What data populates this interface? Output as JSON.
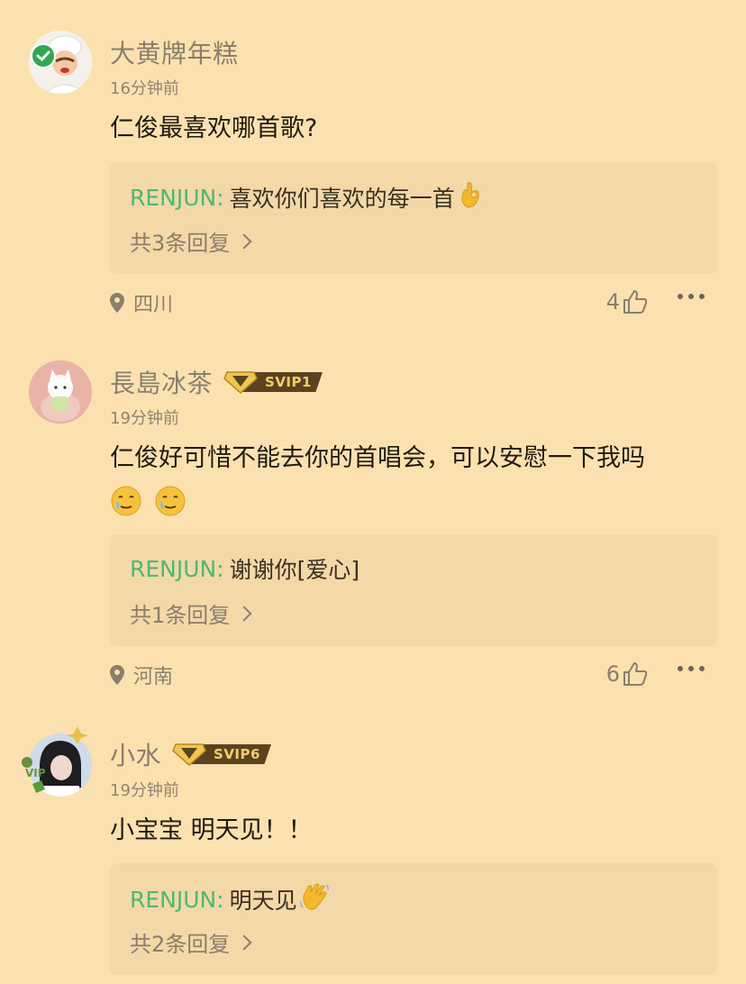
{
  "comments": [
    {
      "username": "大黄牌年糕",
      "time": "16分钟前",
      "text": "仁俊最喜欢哪首歌?",
      "reply": {
        "author": "RENJUN:",
        "text": "喜欢你们喜欢的每一首",
        "count": "共3条回复"
      },
      "location": "四川",
      "likes": "4"
    },
    {
      "username": "長島冰茶",
      "badge": "SVIP1",
      "time": "19分钟前",
      "text": "仁俊好可惜不能去你的首唱会，可以安慰一下我吗",
      "reply": {
        "author": "RENJUN:",
        "text": "谢谢你[爱心]",
        "count": "共1条回复"
      },
      "location": "河南",
      "likes": "6"
    },
    {
      "username": "小水",
      "badge": "SVIP6",
      "time": "19分钟前",
      "text": "小宝宝 明天见！！",
      "reply": {
        "author": "RENJUN:",
        "text": "明天见",
        "count": "共2条回复"
      }
    }
  ],
  "colors": {
    "background": "#fce1b0",
    "reply_box": "#f3d8a8",
    "reply_author": "#4db96f",
    "svip_tag": "#5a4420",
    "svip_text": "#f4cd6a"
  },
  "icons": [
    "verified-check-icon",
    "svip-diamond-icon",
    "location-pin-icon",
    "thumbs-up-icon",
    "more-dots-icon",
    "chevron-right-icon"
  ]
}
